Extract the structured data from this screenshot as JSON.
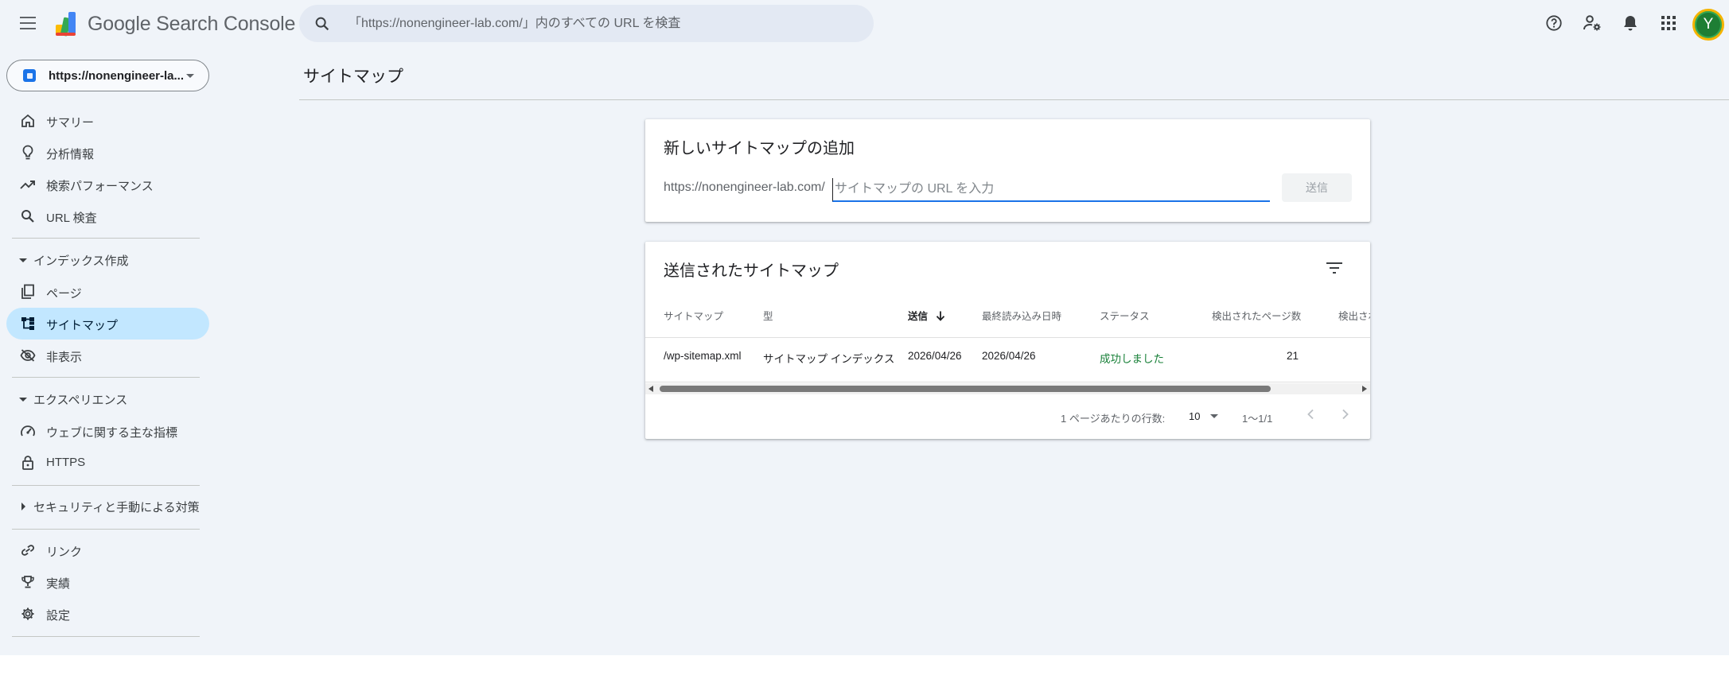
{
  "app": {
    "product_name": "Google Search Console",
    "accent": "#1a73e8",
    "success": "#188038"
  },
  "search": {
    "placeholder": "「https://nonengineer-lab.com/」内のすべての URL を検査"
  },
  "header_icons": [
    "help-icon",
    "manage-users-icon",
    "notifications-icon",
    "apps-grid-icon"
  ],
  "user": {
    "initial": "Y"
  },
  "property": {
    "label": "https://nonengineer-la..."
  },
  "sidebar": {
    "items": [
      {
        "label": "サマリー",
        "icon": "home-icon"
      },
      {
        "label": "分析情報",
        "icon": "lightbulb-icon"
      },
      {
        "label": "検索パフォーマンス",
        "icon": "trending-up-icon"
      },
      {
        "label": "URL 検査",
        "icon": "search-icon"
      }
    ],
    "index_section": "インデックス作成",
    "index_items": [
      {
        "label": "ページ",
        "icon": "pages-icon"
      },
      {
        "label": "サイトマップ",
        "icon": "sitemap-icon",
        "active": true
      },
      {
        "label": "非表示",
        "icon": "visibility-off-icon"
      }
    ],
    "experience_section": "エクスペリエンス",
    "experience_items": [
      {
        "label": "ウェブに関する主な指標",
        "icon": "speed-icon"
      },
      {
        "label": "HTTPS",
        "icon": "lock-icon"
      }
    ],
    "security_section": "セキュリティと手動による対策",
    "bottom_items": [
      {
        "label": "リンク",
        "icon": "link-icon"
      },
      {
        "label": "実績",
        "icon": "trophy-icon"
      },
      {
        "label": "設定",
        "icon": "gear-icon"
      }
    ]
  },
  "page": {
    "title": "サイトマップ"
  },
  "add_card": {
    "title": "新しいサイトマップの追加",
    "prefix": "https://nonengineer-lab.com/",
    "input_placeholder": "サイトマップの URL を入力",
    "input_value": "",
    "submit_label": "送信"
  },
  "list_card": {
    "title": "送信されたサイトマップ",
    "columns": [
      "サイトマップ",
      "型",
      "送信",
      "最終読み込み日時",
      "ステータス",
      "検出されたページ数",
      "検出され"
    ],
    "sorted_column": "送信",
    "rows": [
      {
        "sitemap": "/wp-sitemap.xml",
        "type": "サイトマップ インデックス",
        "submitted": "2026/04/26",
        "last_read": "2026/04/26",
        "status": "成功しました",
        "pages": "21"
      }
    ],
    "pager": {
      "rows_label": "1 ページあたりの行数:",
      "rows_value": "10",
      "range": "1〜1/1"
    }
  }
}
